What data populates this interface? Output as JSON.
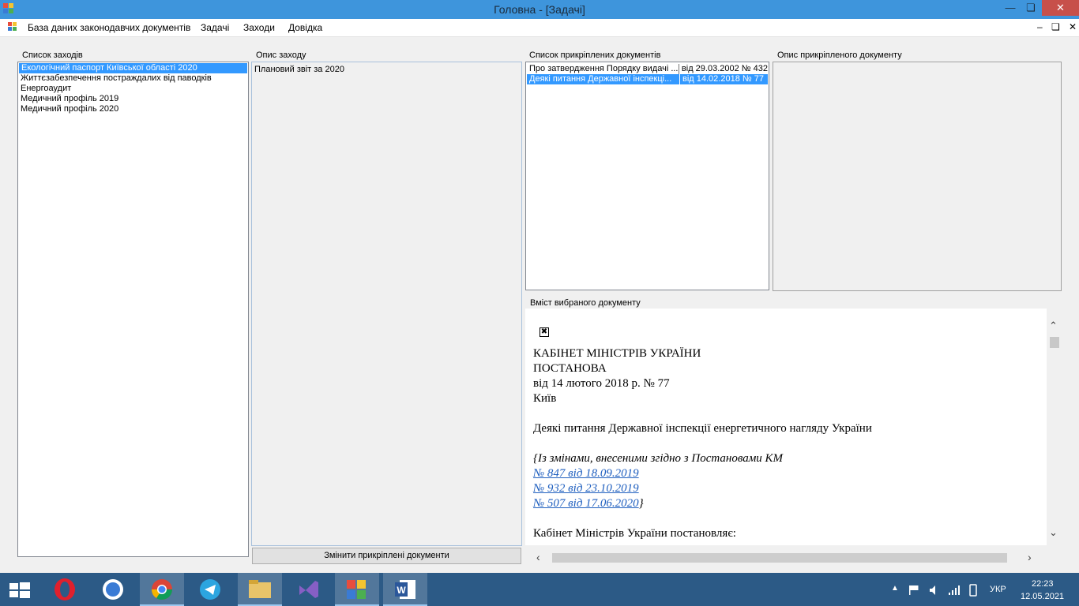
{
  "window": {
    "title": "Головна - [Задачі]"
  },
  "menu": {
    "items": [
      "База даних законодавчих документів",
      "Задачі",
      "Заходи",
      "Довідка"
    ]
  },
  "measures": {
    "label": "Список заходів",
    "items": [
      "Екологічний паспорт Київської області 2020",
      "Життєзабезпечення постраждалих від паводків",
      "Енергоаудит",
      "Медичний профіль 2019",
      "Медичний профіль 2020"
    ],
    "selected_index": 0
  },
  "measure_desc": {
    "label": "Опис заходу",
    "text": "Плановий звіт за 2020"
  },
  "change_docs_button": "Змінити прикріплені документи",
  "attached_docs": {
    "label": "Список прикріплених документів",
    "rows": [
      {
        "title": "Про затвердження Порядку видачі ...",
        "ref": "від 29.03.2002 № 432"
      },
      {
        "title": "Деякі питання Державної інспекці...",
        "ref": "від 14.02.2018 № 77"
      }
    ],
    "selected_index": 1
  },
  "attached_desc": {
    "label": "Опис прикріпленого документу"
  },
  "doc_content": {
    "label": "Вміст вибраного документу",
    "lines": {
      "org": "КАБІНЕТ МІНІСТРІВ УКРАЇНИ",
      "kind": "ПОСТАНОВА",
      "date": "від 14 лютого 2018 р. № 77",
      "city": "Київ",
      "heading": "Деякі питання Державної інспекції енергетичного нагляду України",
      "amend_intro": "{Із змінами, внесеними згідно з Постановами КМ",
      "link1": "№ 847 від 18.09.2019",
      "link2": "№ 932 від 23.10.2019",
      "link3": "№ 507 від 17.06.2020",
      "link3_close": "}",
      "body": "Кабінет Міністрів України постановляє:"
    }
  },
  "taskbar": {
    "lang": "УКР",
    "time": "22:23",
    "date": "12.05.2021"
  },
  "colors": {
    "titlebar": "#3e95dc",
    "selection": "#3399ff",
    "taskbar": "#2c5a86",
    "close": "#c7504a"
  }
}
